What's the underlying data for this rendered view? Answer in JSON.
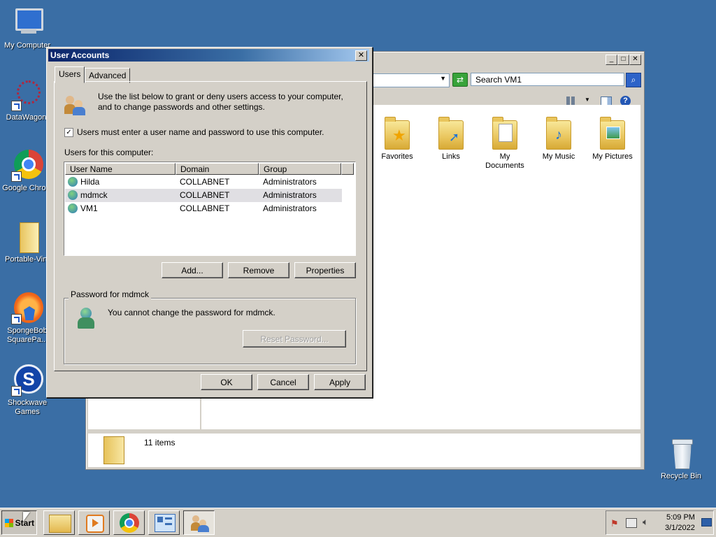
{
  "desktop": {
    "icons": [
      {
        "label": "My Computer"
      },
      {
        "label": "DataWagon."
      },
      {
        "label": "Google Chrom"
      },
      {
        "label": "Portable-Virt."
      },
      {
        "label": "SpongeBob SquarePa..."
      },
      {
        "label": "Shockwave Games"
      },
      {
        "label": "Recycle Bin"
      }
    ]
  },
  "explorer": {
    "search_placeholder": "Search VM1",
    "folders": [
      {
        "label": "Favorites"
      },
      {
        "label": "Links"
      },
      {
        "label": "My Documents"
      },
      {
        "label": "My Music"
      },
      {
        "label": "My Pictures"
      }
    ],
    "status": "11 items"
  },
  "dialog": {
    "title": "User Accounts",
    "close_glyph": "✕",
    "tabs": [
      {
        "label": "Users"
      },
      {
        "label": "Advanced"
      }
    ],
    "intro": "Use the list below to grant or deny users access to your computer, and to change passwords and other settings.",
    "require_login_label": "Users must enter a user name and password to use this computer.",
    "users_label": "Users for this computer:",
    "columns": [
      "User Name",
      "Domain",
      "Group"
    ],
    "users": [
      {
        "name": "Hilda",
        "domain": "COLLABNET",
        "group": "Administrators"
      },
      {
        "name": "mdmck",
        "domain": "COLLABNET",
        "group": "Administrators"
      },
      {
        "name": "VM1",
        "domain": "COLLABNET",
        "group": "Administrators"
      }
    ],
    "add_label": "Add...",
    "remove_label": "Remove",
    "properties_label": "Properties",
    "password_group_label": "Password for mdmck",
    "password_message": "You cannot change the password for mdmck.",
    "reset_label": "Reset Password...",
    "ok_label": "OK",
    "cancel_label": "Cancel",
    "apply_label": "Apply"
  },
  "taskbar": {
    "start_label": "Start",
    "time": "5:09 PM",
    "date": "3/1/2022"
  }
}
